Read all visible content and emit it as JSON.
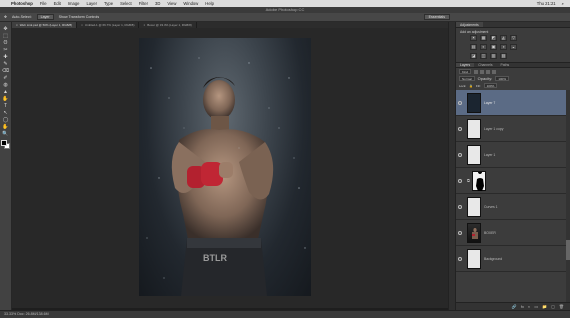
{
  "menubar": {
    "app": "Photoshop",
    "items": [
      "File",
      "Edit",
      "Image",
      "Layer",
      "Type",
      "Select",
      "Filter",
      "3D",
      "View",
      "Window",
      "Help"
    ],
    "clock": "Thu 21:21"
  },
  "window": {
    "title": "Adobe Photoshop CC"
  },
  "options": {
    "auto_select": "Auto-Select:",
    "auto_select_value": "Layer",
    "show_transform": "Show Transform Controls",
    "workspace": "Essentials"
  },
  "tabs": [
    {
      "label": "Web Link.psd @ 50% (Layer 1, RGB/8)",
      "active": true
    },
    {
      "label": "Untitled-1 @ 66.7% (Layer 1, RGB/8)",
      "active": false
    },
    {
      "label": "Boxer @ 33.3% (Layer 1, RGB/8)",
      "active": false
    }
  ],
  "status": {
    "zoom": "33.33%",
    "doc": "Doc: 26.8M/138.6M"
  },
  "panel": {
    "adjustments_tab": "Adjustments",
    "adjustments_title": "Add an adjustment",
    "adjustments_rows": [
      [
        "☀",
        "▦",
        "◩",
        "◭",
        "▽"
      ],
      [
        "▤",
        "◐",
        "▣",
        "◑",
        "◒"
      ],
      [
        "◪",
        "◫",
        "▥",
        "▧"
      ]
    ],
    "layers_tabs": [
      "Layers",
      "Channels",
      "Paths"
    ],
    "kind": "Kind",
    "blend_mode": "Normal",
    "opacity_label": "Opacity:",
    "opacity": "100%",
    "lock_label": "Lock:",
    "fill_label": "Fill:",
    "fill": "100%",
    "bottom_icons": [
      "🔗",
      "fx",
      "◐",
      "▭",
      "📁",
      "▢",
      "🗑"
    ]
  },
  "layers": [
    {
      "name": "Layer 7",
      "thumb": "dark",
      "selected": true
    },
    {
      "name": "Layer 1 copy",
      "thumb": "white",
      "selected": false
    },
    {
      "name": "Layer 1",
      "thumb": "white",
      "selected": false
    },
    {
      "name": "",
      "thumb": "mask",
      "selected": false
    },
    {
      "name": "Curves 1",
      "thumb": "white",
      "selected": false
    },
    {
      "name": "BOXER",
      "thumb": "photo",
      "selected": false
    },
    {
      "name": "Background",
      "thumb": "white",
      "selected": false
    }
  ],
  "tools": [
    "✥",
    "⬚",
    "ʘ",
    "✂",
    "✚",
    "✎",
    "⌫",
    "✐",
    "◍",
    "▲",
    "✋",
    "T",
    "↖",
    "◯",
    "✋",
    "🔍"
  ]
}
